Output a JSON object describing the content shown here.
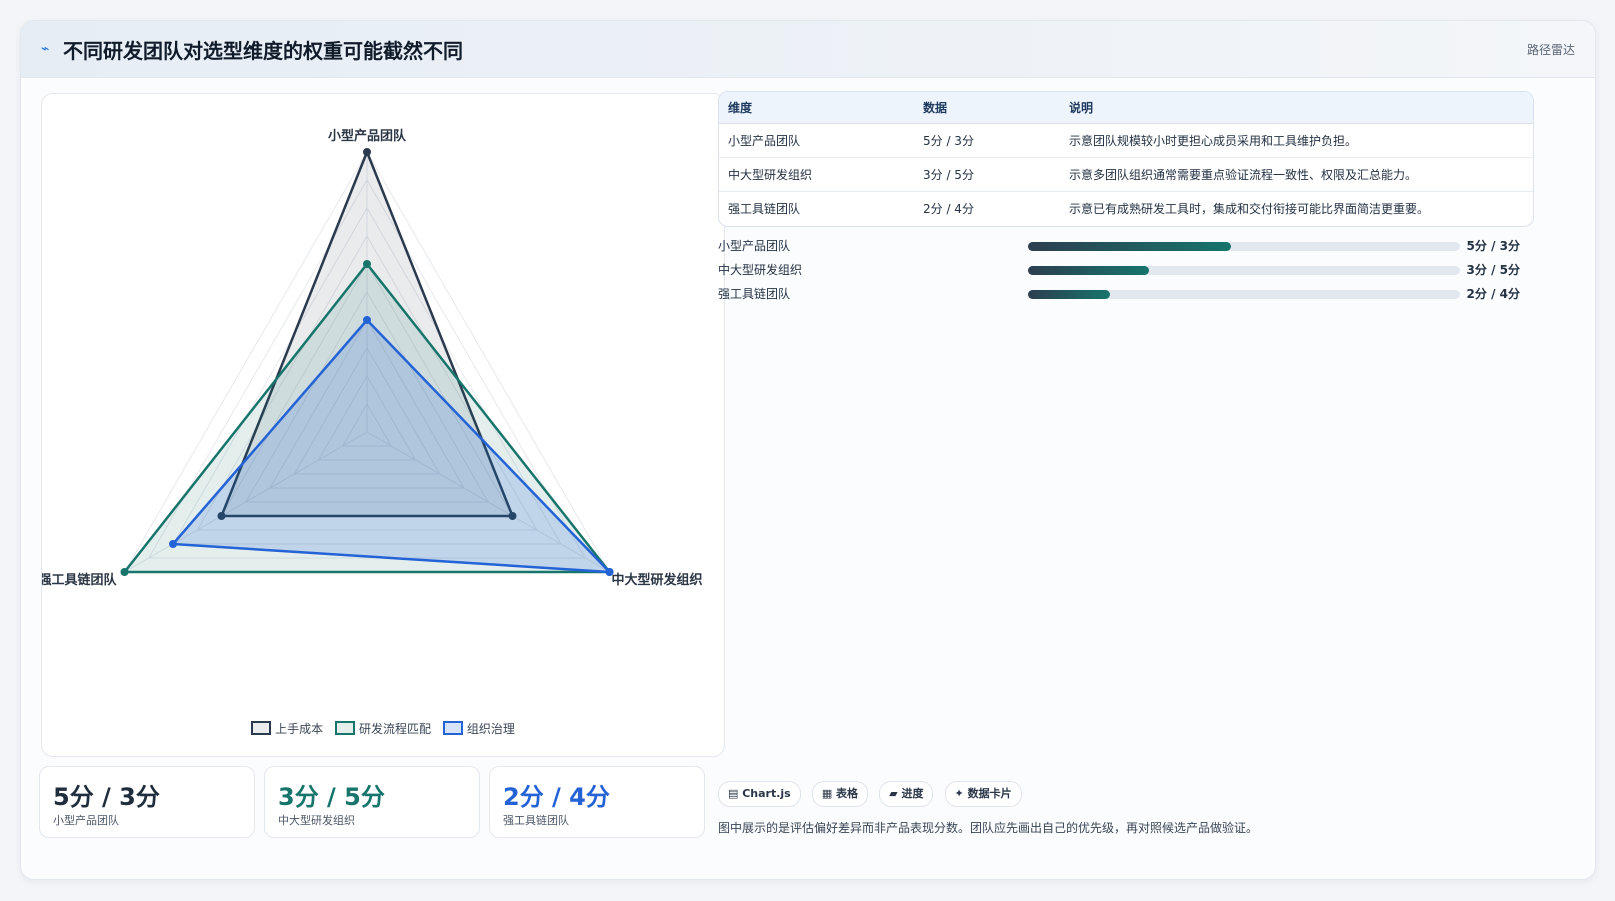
{
  "header": {
    "icon": "trend-icon",
    "title": "不同研发团队对选型维度的权重可能截然不同",
    "tag": "路径雷达"
  },
  "chart_data": {
    "type": "radar",
    "axes": [
      "小型产品团队",
      "中大型研发组织",
      "强工具链团队"
    ],
    "rmax": 5,
    "series": [
      {
        "name": "上手成本",
        "values": [
          5,
          3,
          3
        ],
        "color": "#2b3a4e",
        "fill": "rgba(43,58,78,0.10)"
      },
      {
        "name": "研发流程匹配",
        "values": [
          3,
          5,
          5
        ],
        "color": "#17756b",
        "fill": "rgba(23,117,107,0.12)"
      },
      {
        "name": "组织治理",
        "values": [
          2,
          5,
          4
        ],
        "color": "#2463d6",
        "fill": "rgba(36,99,214,0.18)"
      }
    ]
  },
  "stats": [
    {
      "value": "5分 / 3分",
      "label": "小型产品团队",
      "color": "#1f2d3d"
    },
    {
      "value": "3分 / 5分",
      "label": "中大型研发组织",
      "color": "#17756b"
    },
    {
      "value": "2分 / 4分",
      "label": "强工具链团队",
      "color": "#2463d6"
    }
  ],
  "table": {
    "headers": [
      "维度",
      "数据",
      "说明"
    ],
    "rows": [
      [
        "小型产品团队",
        "5分 / 3分",
        "示意团队规模较小时更担心成员采用和工具维护负担。"
      ],
      [
        "中大型研发组织",
        "3分 / 5分",
        "示意多团队组织通常需要重点验证流程一致性、权限及汇总能力。"
      ],
      [
        "强工具链团队",
        "2分 / 4分",
        "示意已有成熟研发工具时，集成和交付衔接可能比界面简洁更重要。"
      ]
    ]
  },
  "bars": [
    {
      "label": "小型产品团队",
      "value": "5分 / 3分",
      "fraction": 0.47
    },
    {
      "label": "中大型研发组织",
      "value": "3分 / 5分",
      "fraction": 0.28
    },
    {
      "label": "强工具链团队",
      "value": "2分 / 4分",
      "fraction": 0.19
    }
  ],
  "chips": [
    "▤ Chart.js",
    "▦ 表格",
    "▰ 进度",
    "✦ 数据卡片"
  ],
  "footnote": "图中展示的是评估偏好差异而非产品表现分数。团队应先画出自己的优先级，再对照候选产品做验证。"
}
